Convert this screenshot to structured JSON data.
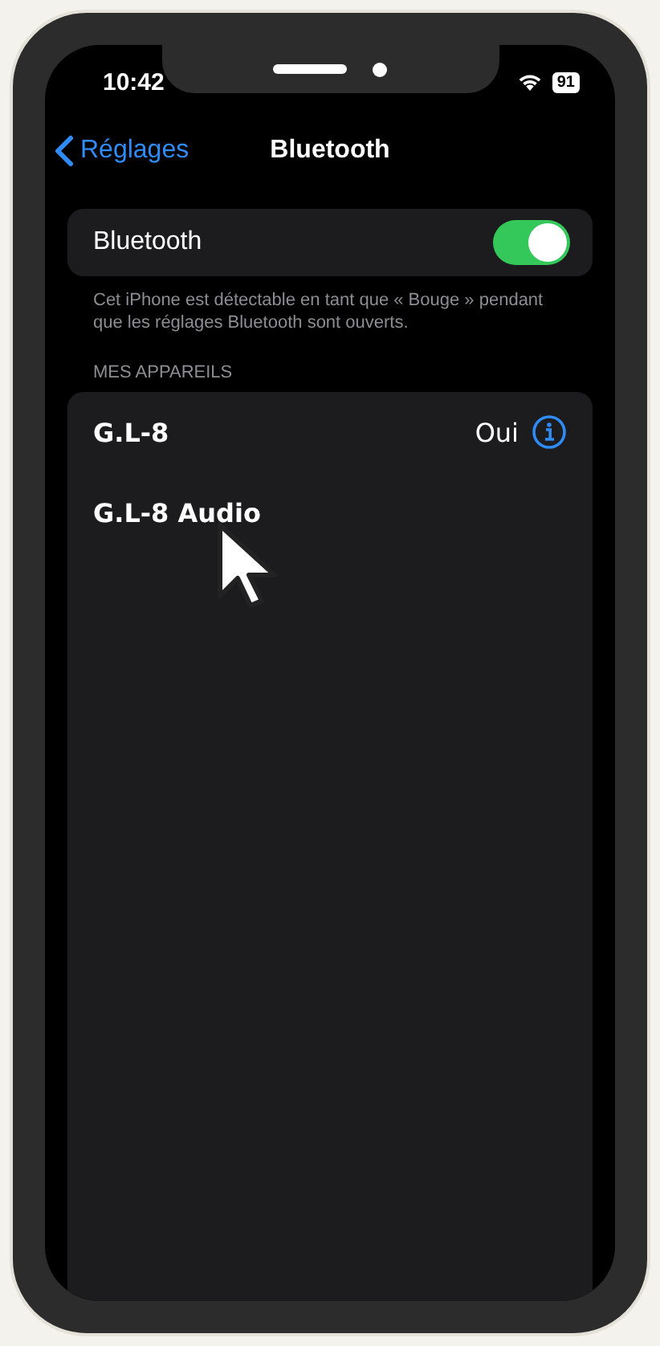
{
  "status_bar": {
    "time": "10:42",
    "battery": "91"
  },
  "nav": {
    "back": "Réglages",
    "title": "Bluetooth"
  },
  "bluetooth": {
    "label": "Bluetooth",
    "on": true,
    "footer": "Cet iPhone est détectable en tant que « Bouge » pendant que les réglages Bluetooth sont ouverts."
  },
  "section": "MES APPAREILS",
  "devices": [
    {
      "name": "G.L-8",
      "status": "Oui",
      "info": true
    },
    {
      "name": "G.L-8 Audio",
      "info": false
    }
  ]
}
